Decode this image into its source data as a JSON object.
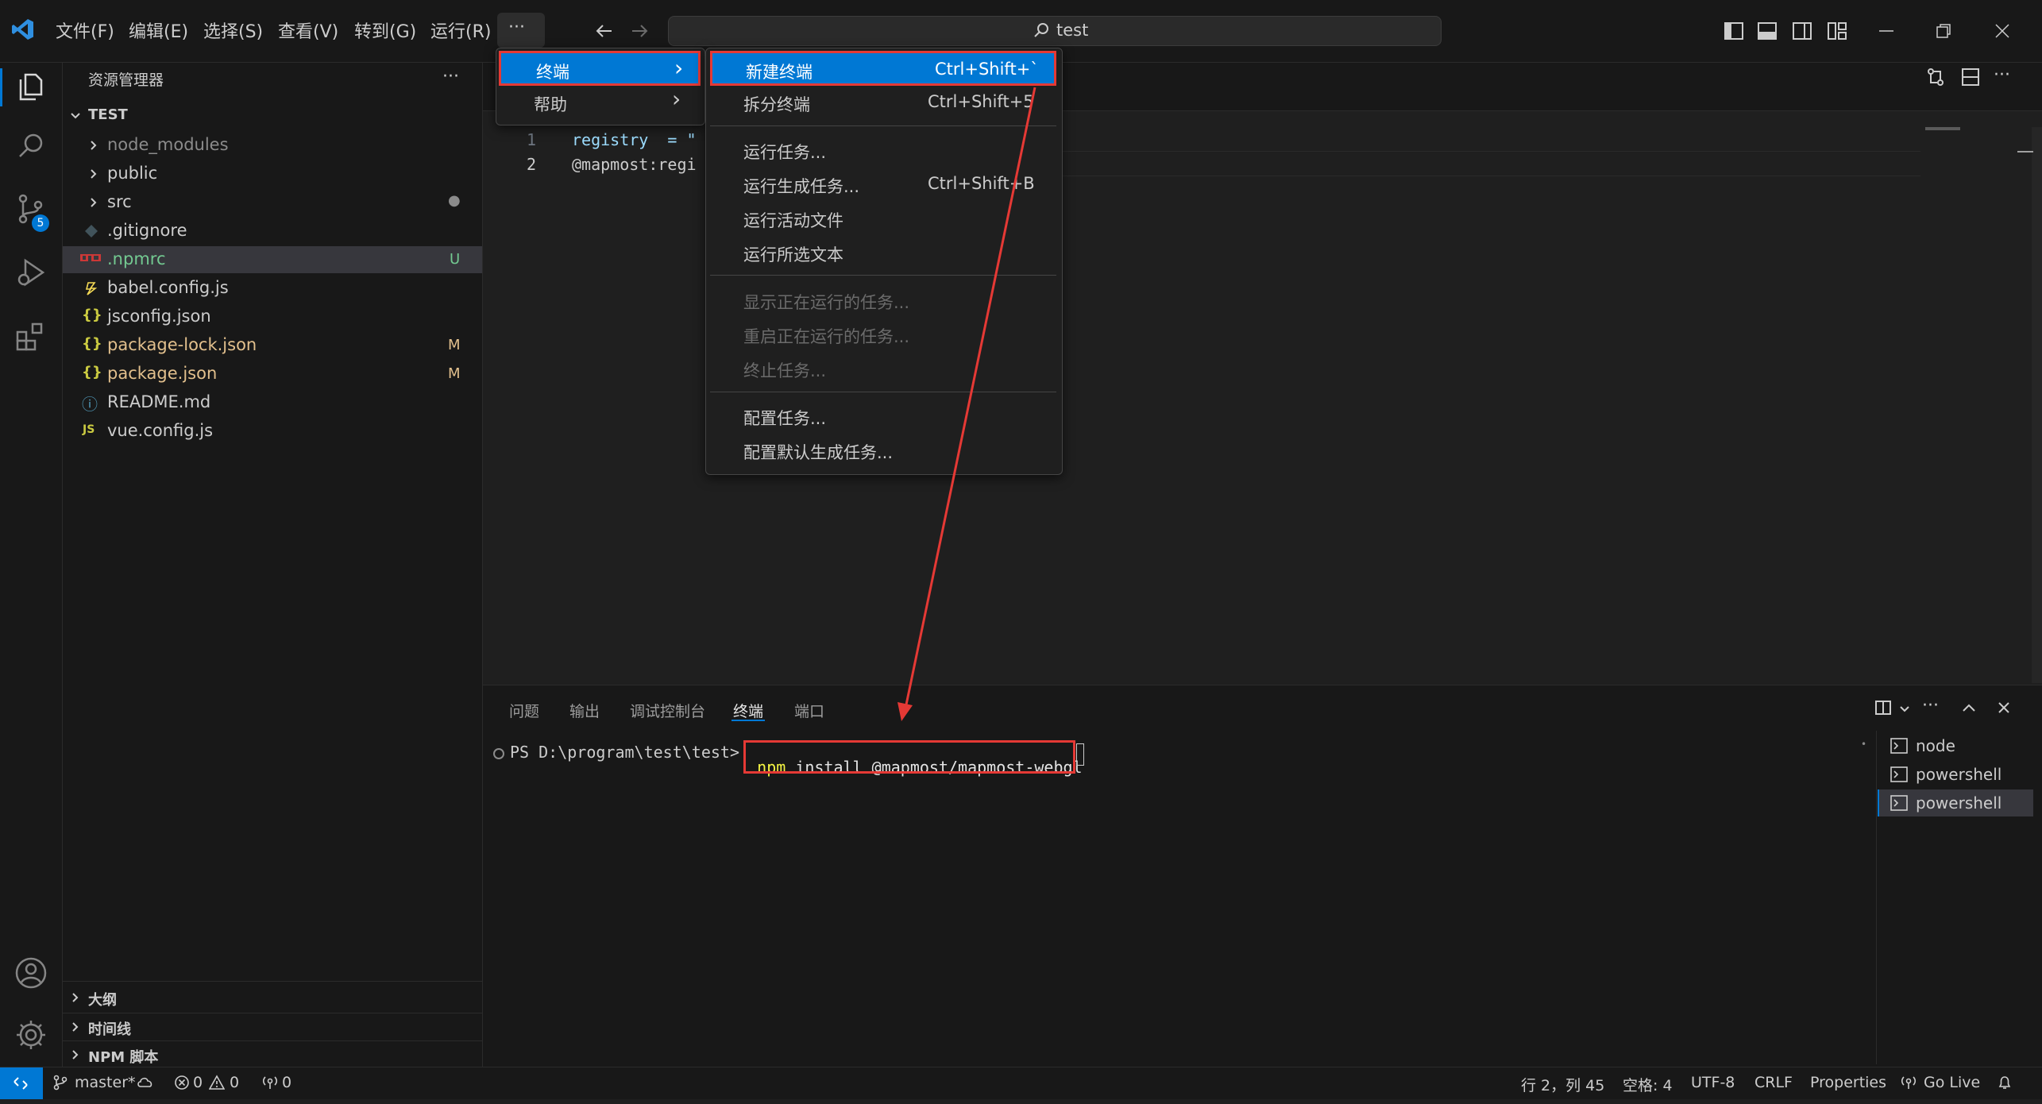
{
  "titlebar": {
    "menus": [
      "文件(F)",
      "编辑(E)",
      "选择(S)",
      "查看(V)",
      "转到(G)",
      "运行(R)"
    ],
    "more": "···",
    "search": "test"
  },
  "sidebar": {
    "title": "资源管理器",
    "more": "···",
    "root": "TEST",
    "items": [
      {
        "label": "node_modules",
        "badge": ""
      },
      {
        "label": "public",
        "badge": ""
      },
      {
        "label": "src",
        "badge": "●"
      },
      {
        "label": ".gitignore",
        "badge": ""
      },
      {
        "label": ".npmrc",
        "badge": "U"
      },
      {
        "label": "babel.config.js",
        "badge": ""
      },
      {
        "label": "jsconfig.json",
        "badge": ""
      },
      {
        "label": "package-lock.json",
        "badge": "M"
      },
      {
        "label": "package.json",
        "badge": "M"
      },
      {
        "label": "README.md",
        "badge": ""
      },
      {
        "label": "vue.config.js",
        "badge": ""
      }
    ],
    "icons": {
      "braces": "{}",
      "js": "JS",
      "info": "ⓘ"
    },
    "sections": [
      "大纲",
      "时间线",
      "NPM 脚本"
    ],
    "scm_badge": "5"
  },
  "editor": {
    "lines": [
      {
        "num": "1",
        "code": "registry  = \""
      },
      {
        "num": "2",
        "code": "@mapmost:regi"
      }
    ]
  },
  "menu": {
    "level1": [
      {
        "label": "终端",
        "arrow": "›"
      },
      {
        "label": "帮助",
        "arrow": "›"
      }
    ],
    "submenu": [
      {
        "label": "新建终端",
        "key": "Ctrl+Shift+`"
      },
      {
        "label": "拆分终端",
        "key": "Ctrl+Shift+5"
      },
      {
        "label": "运行任务...",
        "key": ""
      },
      {
        "label": "运行生成任务...",
        "key": "Ctrl+Shift+B"
      },
      {
        "label": "运行活动文件",
        "key": ""
      },
      {
        "label": "运行所选文本",
        "key": ""
      },
      {
        "label": "显示正在运行的任务...",
        "key": ""
      },
      {
        "label": "重启正在运行的任务...",
        "key": ""
      },
      {
        "label": "终止任务...",
        "key": ""
      },
      {
        "label": "配置任务...",
        "key": ""
      },
      {
        "label": "配置默认生成任务...",
        "key": ""
      }
    ]
  },
  "panel": {
    "tabs": [
      "问题",
      "输出",
      "调试控制台",
      "终端",
      "端口"
    ],
    "active_tab": "终端",
    "prompt": "PS D:\\program\\test\\test>",
    "cmd_npm": "npm",
    "cmd_rest": " install @mapmost/mapmost-webgl",
    "terminals": [
      "node",
      "powershell",
      "powershell"
    ]
  },
  "statusbar": {
    "branch": "master*",
    "errors": "0",
    "warnings": "0",
    "ports": "0",
    "position": "行 2，列 45",
    "spaces": "空格: 4",
    "encoding": "UTF-8",
    "eol": "CRLF",
    "language": "Properties",
    "golive": "Go Live"
  },
  "colors": {
    "accent": "#0078d4",
    "highlight_box": "#e53935",
    "untracked": "#73c991",
    "modified": "#e2c08d"
  }
}
